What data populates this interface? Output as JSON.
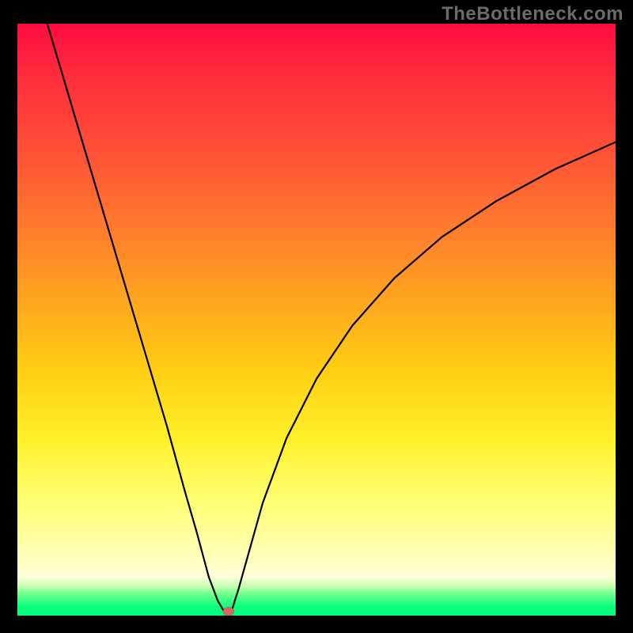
{
  "watermark": "TheBottleneck.com",
  "chart_data": {
    "type": "line",
    "title": "",
    "xlabel": "",
    "ylabel": "",
    "xlim": [
      0,
      100
    ],
    "ylim": [
      0,
      100
    ],
    "grid": false,
    "legend": false,
    "series": [
      {
        "name": "left-branch",
        "x": [
          5,
          10,
          15,
          20,
          25,
          28,
          30,
          32,
          33.5,
          34.5,
          35,
          35.3
        ],
        "y": [
          100,
          83,
          66,
          49,
          32,
          21,
          14,
          6.5,
          2.5,
          0.8,
          0.15,
          0
        ]
      },
      {
        "name": "right-branch",
        "x": [
          35.3,
          35.6,
          36,
          37,
          38.5,
          41,
          45,
          50,
          56,
          63,
          71,
          80,
          90,
          100
        ],
        "y": [
          0,
          0.4,
          1.4,
          4.6,
          10,
          19,
          30,
          40,
          49,
          57,
          64,
          70,
          75.5,
          80
        ]
      }
    ],
    "marker": {
      "x": 35.3,
      "y": 0.7,
      "color": "#d46a5f"
    },
    "gradient_stops": [
      {
        "pos": 0.0,
        "color": "#ff0b3f"
      },
      {
        "pos": 0.08,
        "color": "#ff2a3c"
      },
      {
        "pos": 0.22,
        "color": "#ff5236"
      },
      {
        "pos": 0.34,
        "color": "#ff7a2d"
      },
      {
        "pos": 0.46,
        "color": "#ffa31f"
      },
      {
        "pos": 0.58,
        "color": "#ffcc12"
      },
      {
        "pos": 0.7,
        "color": "#fff029"
      },
      {
        "pos": 0.8,
        "color": "#ffff6e"
      },
      {
        "pos": 0.88,
        "color": "#ffffa8"
      },
      {
        "pos": 0.935,
        "color": "#ffffd9"
      },
      {
        "pos": 0.95,
        "color": "#c8ffb0"
      },
      {
        "pos": 0.965,
        "color": "#66ff8a"
      },
      {
        "pos": 0.985,
        "color": "#0bff7d"
      },
      {
        "pos": 1.0,
        "color": "#00ff7f"
      }
    ]
  }
}
